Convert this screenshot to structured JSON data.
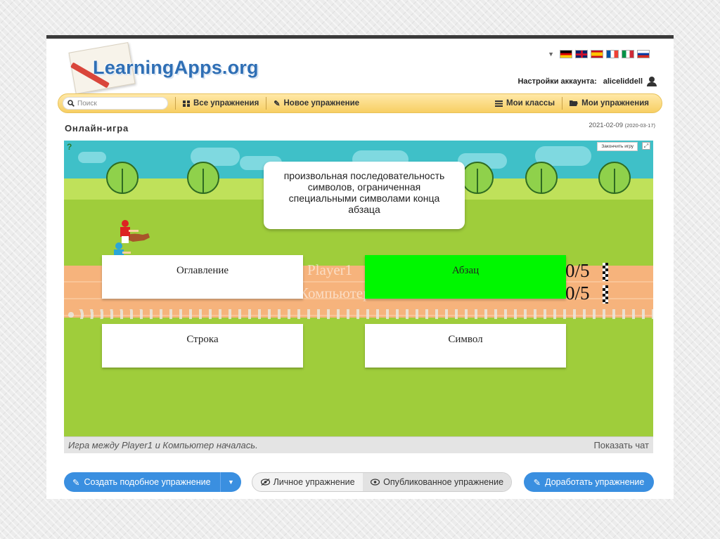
{
  "logo": {
    "text": "LearningApps.org"
  },
  "account": {
    "label": "Настройки аккаунта:",
    "username": "aliceliddell"
  },
  "language_flags": [
    {
      "name": "de",
      "colors": [
        "#000000",
        "#dd0000",
        "#ffce00"
      ]
    },
    {
      "name": "en",
      "colors": [
        "#012169",
        "#ffffff",
        "#c8102e"
      ]
    },
    {
      "name": "es",
      "colors": [
        "#c60b1e",
        "#ffc400",
        "#c60b1e"
      ]
    },
    {
      "name": "fr",
      "colors": [
        "#0055a4",
        "#ffffff",
        "#ef4135"
      ]
    },
    {
      "name": "it",
      "colors": [
        "#009246",
        "#ffffff",
        "#ce2b37"
      ]
    },
    {
      "name": "ru",
      "colors": [
        "#ffffff",
        "#0039a6",
        "#d52b1e"
      ]
    }
  ],
  "nav": {
    "search_placeholder": "Поиск",
    "all_exercises": "Все упражнения",
    "new_exercise": "Новое упражнение",
    "my_classes": "Мои классы",
    "my_exercises": "Мои упражнения"
  },
  "page": {
    "title": "Онлайн-игра",
    "date": "2021-02-09",
    "date_small": "(2020-03-17)"
  },
  "game": {
    "finish_label": "Закончить игру",
    "question": "произвольная последовательность символов, ограниченная специальными символами конца абзаца",
    "player_ghost": "Player1",
    "computer_ghost": "Компьютер",
    "answers": [
      "Оглавление",
      "Абзац",
      "Строка",
      "Символ"
    ],
    "selected_answer_index": 1,
    "scores": [
      "0/5",
      "0/5"
    ],
    "status_message": "Игра между Player1 и Компьютер началась.",
    "show_chat": "Показать чат",
    "colors": {
      "sky": "#3fc0c8",
      "grass": "#9fcd3b",
      "selected": "#00f700"
    }
  },
  "actions": {
    "create_similar": "Создать подобное упражнение",
    "private_exercise": "Личное упражнение",
    "published_exercise": "Опубликованное упражнение",
    "improve_exercise": "Доработать упражнение",
    "accent": "#3a8fe0"
  }
}
